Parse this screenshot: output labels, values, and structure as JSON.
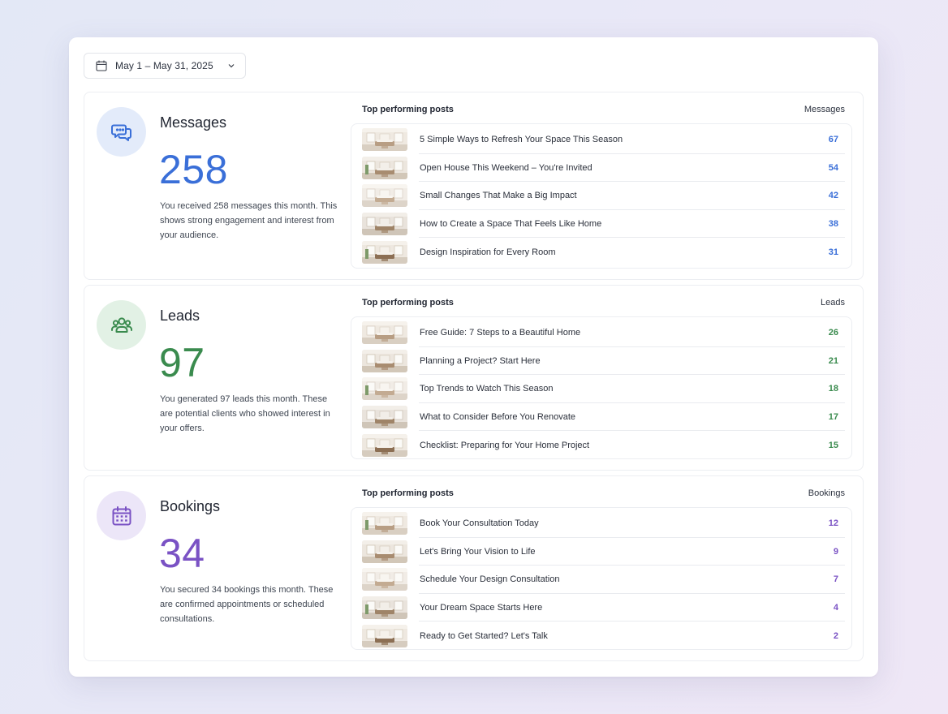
{
  "date_range": {
    "label": "May 1 – May 31, 2025"
  },
  "sections": [
    {
      "key": "messages",
      "title": "Messages",
      "value": "258",
      "description": "You received 258 messages this month. This shows strong engagement and interest from your audience.",
      "icon": "chat-bubbles-icon",
      "accent_color": "#3a6fd8",
      "icon_bg": "#e3ebfa",
      "panel_label": "Top performing posts",
      "column_label": "Messages",
      "posts": [
        {
          "title": "5 Simple Ways to Refresh Your Space This Season",
          "value": "67"
        },
        {
          "title": "Open House This Weekend – You're Invited",
          "value": "54"
        },
        {
          "title": "Small Changes That Make a Big Impact",
          "value": "42"
        },
        {
          "title": "How to Create a Space That Feels Like Home",
          "value": "38"
        },
        {
          "title": "Design Inspiration for Every Room",
          "value": "31"
        }
      ]
    },
    {
      "key": "leads",
      "title": "Leads",
      "value": "97",
      "description": "You generated 97 leads this month. These are potential clients who showed interest in your offers.",
      "icon": "users-group-icon",
      "accent_color": "#3a8b4e",
      "icon_bg": "#e2f1e5",
      "panel_label": "Top performing posts",
      "column_label": "Leads",
      "posts": [
        {
          "title": "Free Guide: 7 Steps to a Beautiful Home",
          "value": "26"
        },
        {
          "title": "Planning a Project? Start Here",
          "value": "21"
        },
        {
          "title": "Top Trends to Watch This Season",
          "value": "18"
        },
        {
          "title": "What to Consider Before You Renovate",
          "value": "17"
        },
        {
          "title": "Checklist: Preparing for Your Home Project",
          "value": "15"
        }
      ]
    },
    {
      "key": "bookings",
      "title": "Bookings",
      "value": "34",
      "description": "You secured 34 bookings this month. These are confirmed appointments or scheduled consultations.",
      "icon": "calendar-icon",
      "accent_color": "#7a52c4",
      "icon_bg": "#ece6f8",
      "panel_label": "Top performing posts",
      "column_label": "Bookings",
      "posts": [
        {
          "title": "Book Your Consultation Today",
          "value": "12"
        },
        {
          "title": "Let's Bring Your Vision to Life",
          "value": "9"
        },
        {
          "title": "Schedule Your Design Consultation",
          "value": "7"
        },
        {
          "title": "Your Dream Space Starts Here",
          "value": "4"
        },
        {
          "title": "Ready to Get Started? Let's Talk",
          "value": "2"
        }
      ]
    }
  ]
}
